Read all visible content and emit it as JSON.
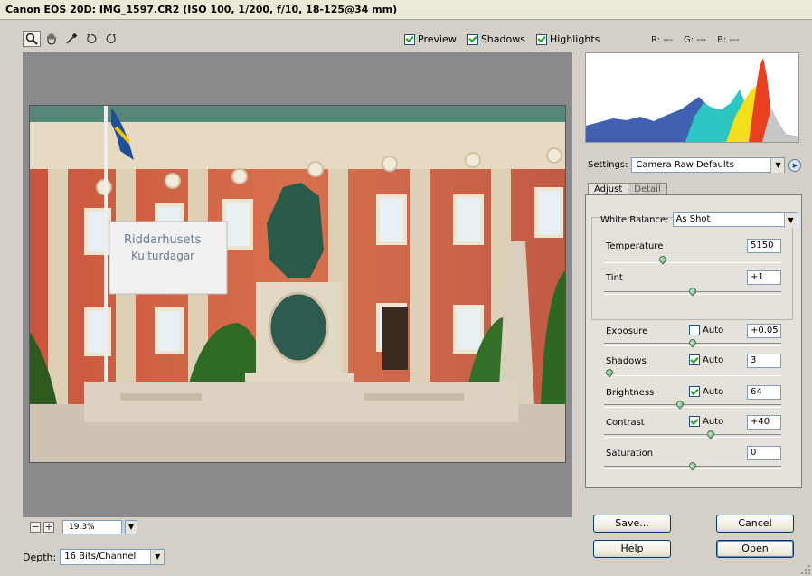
{
  "window": {
    "title": "Canon EOS 20D:  IMG_1597.CR2  (ISO 100, 1/200, f/10, 18-125@34 mm)"
  },
  "tools": [
    {
      "name": "zoom-tool",
      "icon": "zoom-icon"
    },
    {
      "name": "hand-tool",
      "icon": "hand-icon"
    },
    {
      "name": "white-balance-tool",
      "icon": "eyedropper-icon"
    },
    {
      "name": "rotate-left-tool",
      "icon": "rotate-ccw-icon"
    },
    {
      "name": "rotate-right-tool",
      "icon": "rotate-cw-icon"
    }
  ],
  "view_options": {
    "preview": {
      "label": "Preview",
      "checked": true
    },
    "shadows": {
      "label": "Shadows",
      "checked": true
    },
    "highlights": {
      "label": "Highlights",
      "checked": true
    }
  },
  "rgb_readout": {
    "r": "R: ---",
    "g": "G: ---",
    "b": "B: ---"
  },
  "zoom": {
    "minus": "−",
    "plus": "+",
    "value": "19.3%"
  },
  "depth": {
    "label": "Depth:",
    "value": "16 Bits/Channel"
  },
  "settings": {
    "label": "Settings:",
    "value": "Camera Raw Defaults"
  },
  "tabs": [
    {
      "label": "Adjust",
      "active": true
    },
    {
      "label": "Detail",
      "active": false
    }
  ],
  "white_balance": {
    "label": "White Balance:",
    "value": "As Shot"
  },
  "adjustments": {
    "temperature": {
      "label": "Temperature",
      "value": "5150",
      "level": 0.33
    },
    "tint": {
      "label": "Tint",
      "value": "+1",
      "level": 0.5
    },
    "exposure": {
      "label": "Exposure",
      "value": "+0.05",
      "auto_label": "Auto",
      "auto": false,
      "level": 0.5
    },
    "shadows": {
      "label": "Shadows",
      "value": "3",
      "auto_label": "Auto",
      "auto": true,
      "level": 0.03
    },
    "brightness": {
      "label": "Brightness",
      "value": "64",
      "auto_label": "Auto",
      "auto": true,
      "level": 0.43
    },
    "contrast": {
      "label": "Contrast",
      "value": "+40",
      "auto_label": "Auto",
      "auto": true,
      "level": 0.6
    },
    "saturation": {
      "label": "Saturation",
      "value": "0",
      "level": 0.5
    }
  },
  "buttons": {
    "save": "Save...",
    "cancel": "Cancel",
    "help": "Help",
    "open": "Open"
  },
  "photo_banner": {
    "line1": "Riddarhusets",
    "line2": "Kulturdagar"
  },
  "colors": {
    "panel": "#d4d0c8",
    "preview_bg": "#8a8a8c",
    "check": "#21a121"
  }
}
